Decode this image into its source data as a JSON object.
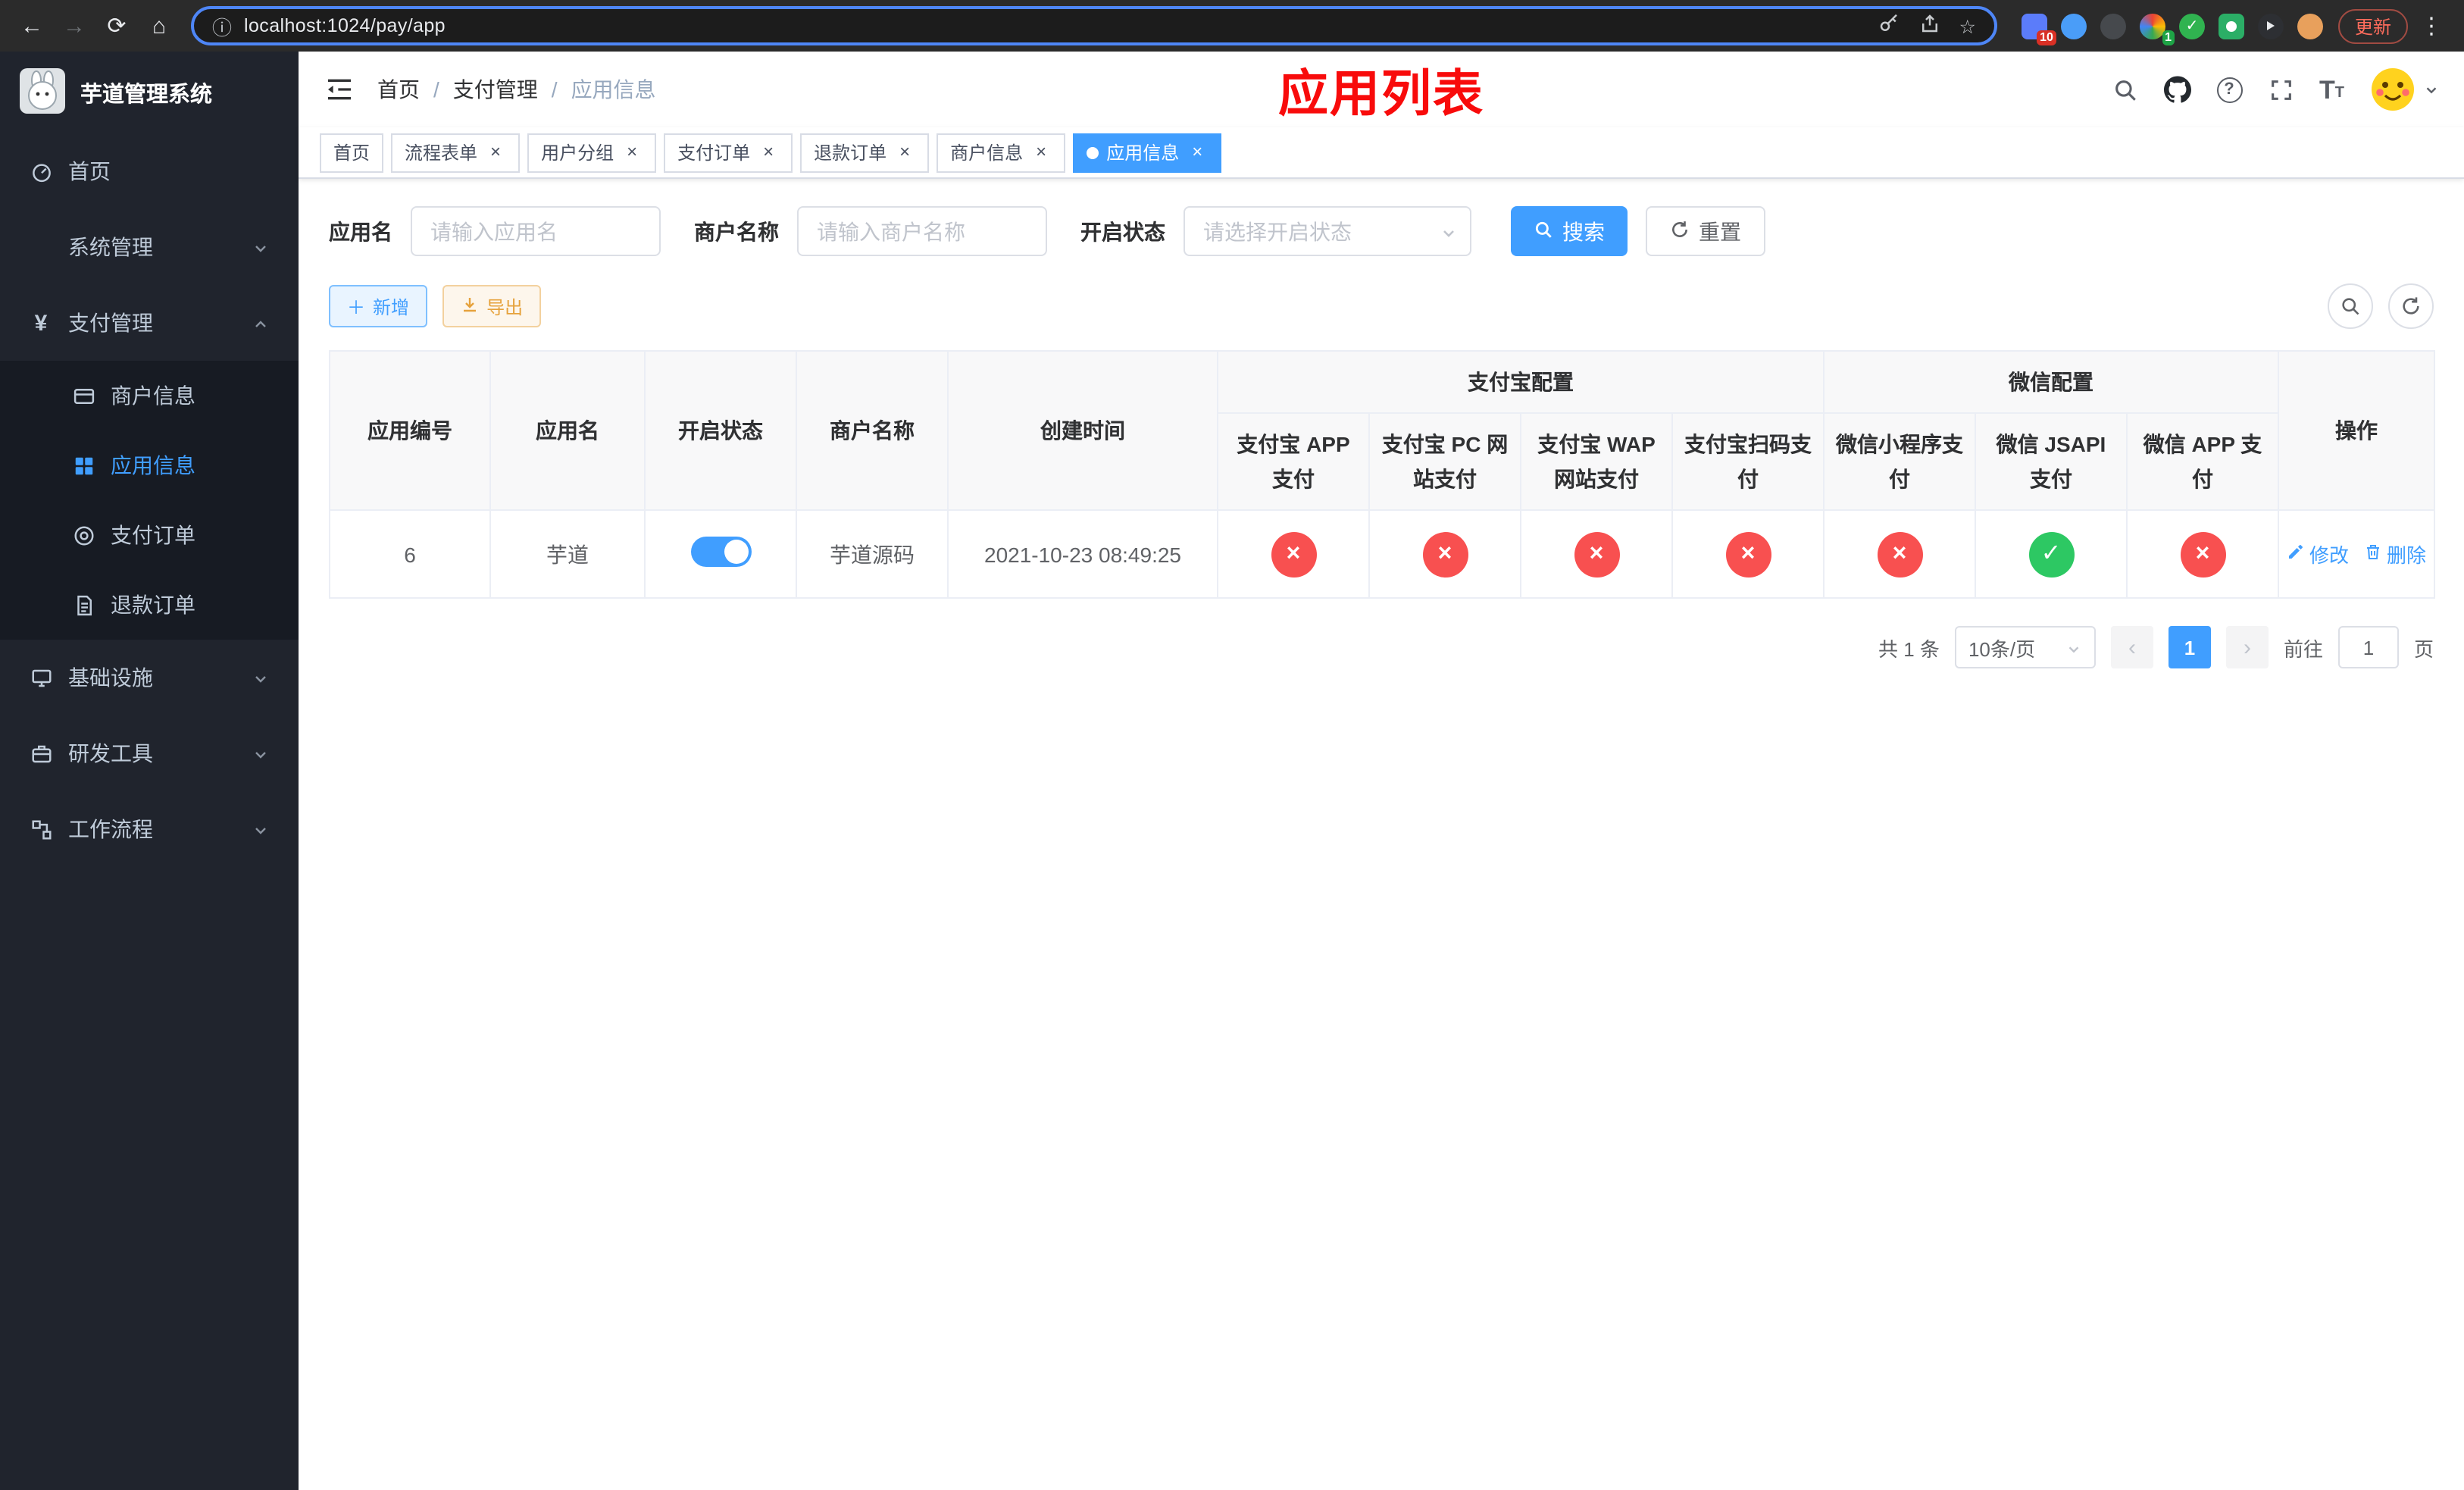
{
  "browser": {
    "url": "localhost:1024/pay/app",
    "update_label": "更新",
    "ext_badge_10": "10",
    "ext_badge_1": "1"
  },
  "icons": {
    "back": "←",
    "forward": "→",
    "reload": "⟳",
    "home": "⌂",
    "info": "ⓘ",
    "star": "☆",
    "menu_dots": "⋮",
    "close": "×",
    "slash": "/",
    "plus": "＋",
    "cross": "×",
    "check": "✓",
    "question": "?",
    "yen": "¥",
    "text_size_big": "T",
    "text_size_small": "T",
    "prev": "‹",
    "next": "›"
  },
  "sidebar": {
    "logo_title": "芋道管理系统",
    "menu": {
      "home": "首页",
      "system": "系统管理",
      "payment": "支付管理",
      "infra": "基础设施",
      "devtools": "研发工具",
      "workflow": "工作流程"
    },
    "payment_children": {
      "merchant": "商户信息",
      "app_info": "应用信息",
      "pay_order": "支付订单",
      "refund_order": "退款订单"
    }
  },
  "header": {
    "breadcrumb": [
      "首页",
      "支付管理",
      "应用信息"
    ],
    "overlay_title": "应用列表"
  },
  "tags": [
    {
      "label": "首页"
    },
    {
      "label": "流程表单"
    },
    {
      "label": "用户分组"
    },
    {
      "label": "支付订单"
    },
    {
      "label": "退款订单"
    },
    {
      "label": "商户信息"
    },
    {
      "label": "应用信息",
      "active": true
    }
  ],
  "filters": {
    "app_name_label": "应用名",
    "app_name_placeholder": "请输入应用名",
    "merchant_label": "商户名称",
    "merchant_placeholder": "请输入商户名称",
    "status_label": "开启状态",
    "status_placeholder": "请选择开启状态",
    "search_label": "搜索",
    "reset_label": "重置"
  },
  "toolbar": {
    "add_label": "新增",
    "export_label": "导出"
  },
  "table": {
    "groups": {
      "alipay": "支付宝配置",
      "wechat": "微信配置"
    },
    "columns": [
      "应用编号",
      "应用名",
      "开启状态",
      "商户名称",
      "创建时间",
      "支付宝 APP 支付",
      "支付宝 PC 网站支付",
      "支付宝 WAP 网站支付",
      "支付宝扫码支付",
      "微信小程序支付",
      "微信 JSAPI 支付",
      "微信 APP 支付",
      "操作"
    ],
    "rows": [
      {
        "id": "6",
        "name": "芋道",
        "enabled": true,
        "merchant": "芋道源码",
        "created_at": "2021-10-23 08:49:25",
        "configs": [
          false,
          false,
          false,
          false,
          false,
          true,
          false
        ],
        "edit_label": "修改",
        "delete_label": "删除"
      }
    ]
  },
  "pagination": {
    "total_label": "共 1 条",
    "page_size_label": "10条/页",
    "current_page": "1",
    "goto_label": "前往",
    "goto_value": "1",
    "goto_suffix": "页"
  }
}
